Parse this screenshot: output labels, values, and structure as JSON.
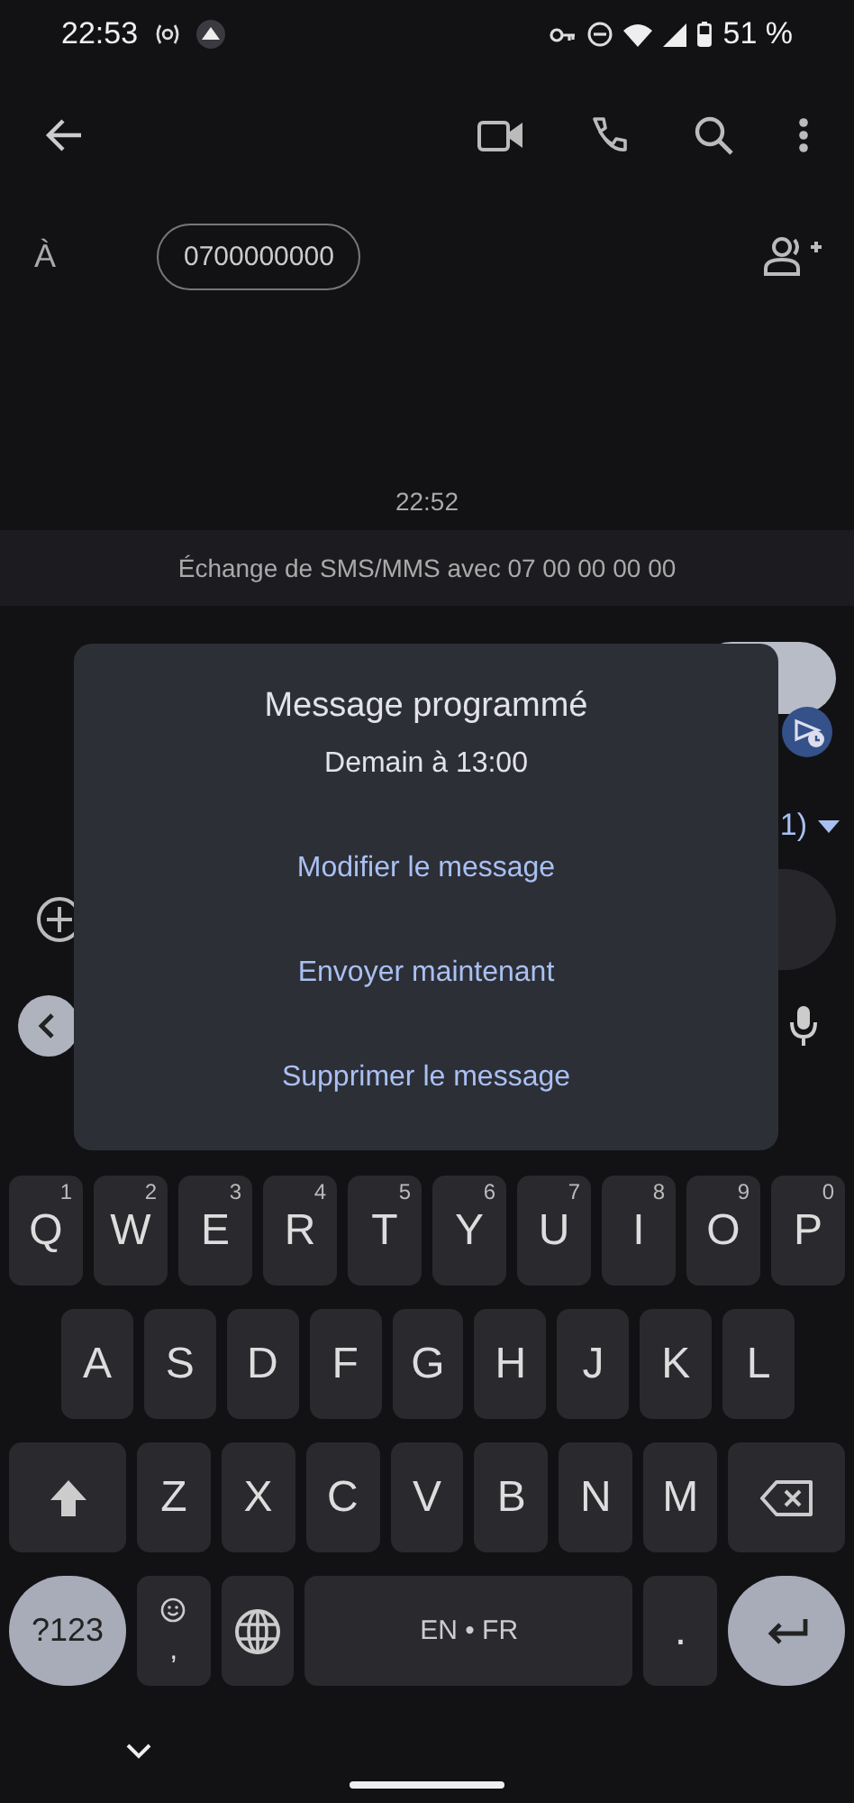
{
  "status_bar": {
    "time": "22:53",
    "battery": "51 %"
  },
  "recipient": {
    "label": "À",
    "chip": "0700000000"
  },
  "conversation": {
    "timestamp": "22:52",
    "info": "Échange de SMS/MMS avec 07 00 00 00 00",
    "sim_label": "1)"
  },
  "dialog": {
    "title": "Message programmé",
    "subtitle": "Demain à 13:00",
    "actions": [
      "Modifier le message",
      "Envoyer maintenant",
      "Supprimer le message"
    ]
  },
  "keyboard": {
    "rows": [
      {
        "keys": [
          {
            "kind": "letter",
            "label": "Q",
            "hint": "1"
          },
          {
            "kind": "letter",
            "label": "W",
            "hint": "2"
          },
          {
            "kind": "letter",
            "label": "E",
            "hint": "3"
          },
          {
            "kind": "letter",
            "label": "R",
            "hint": "4"
          },
          {
            "kind": "letter",
            "label": "T",
            "hint": "5"
          },
          {
            "kind": "letter",
            "label": "Y",
            "hint": "6"
          },
          {
            "kind": "letter",
            "label": "U",
            "hint": "7"
          },
          {
            "kind": "letter",
            "label": "I",
            "hint": "8"
          },
          {
            "kind": "letter",
            "label": "O",
            "hint": "9"
          },
          {
            "kind": "letter",
            "label": "P",
            "hint": "0"
          }
        ]
      },
      {
        "keys": [
          {
            "kind": "letter",
            "label": "A"
          },
          {
            "kind": "letter",
            "label": "S"
          },
          {
            "kind": "letter",
            "label": "D"
          },
          {
            "kind": "letter",
            "label": "F"
          },
          {
            "kind": "letter",
            "label": "G"
          },
          {
            "kind": "letter",
            "label": "H"
          },
          {
            "kind": "letter",
            "label": "J"
          },
          {
            "kind": "letter",
            "label": "K"
          },
          {
            "kind": "letter",
            "label": "L"
          }
        ]
      },
      {
        "keys": [
          {
            "kind": "shift"
          },
          {
            "kind": "letter",
            "label": "Z"
          },
          {
            "kind": "letter",
            "label": "X"
          },
          {
            "kind": "letter",
            "label": "C"
          },
          {
            "kind": "letter",
            "label": "V"
          },
          {
            "kind": "letter",
            "label": "B"
          },
          {
            "kind": "letter",
            "label": "N"
          },
          {
            "kind": "letter",
            "label": "M"
          },
          {
            "kind": "backspace"
          }
        ]
      },
      {
        "keys": [
          {
            "kind": "symbols",
            "label": "?123"
          },
          {
            "kind": "emoji",
            "label": ","
          },
          {
            "kind": "globe"
          },
          {
            "kind": "space",
            "label": "EN • FR"
          },
          {
            "kind": "letter",
            "label": "."
          },
          {
            "kind": "enter"
          }
        ]
      }
    ]
  }
}
